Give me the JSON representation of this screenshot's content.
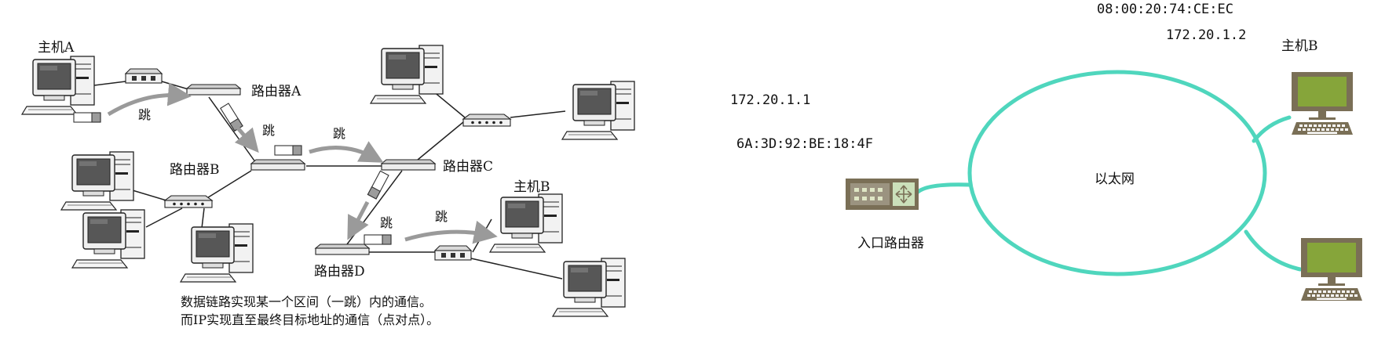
{
  "left_diagram": {
    "host_a_label": "主机A",
    "host_b_label": "主机B",
    "router_a_label": "路由器A",
    "router_b_label": "路由器B",
    "router_c_label": "路由器C",
    "router_d_label": "路由器D",
    "hop_label": "跳",
    "caption_line1": "数据链路实现某一个区间（一跳）内的通信。",
    "caption_line2": "而IP实现直至最终目标地址的通信（点对点）。"
  },
  "right_diagram": {
    "router_ip": "172.20.1.1",
    "router_mac": "6A:3D:92:BE:18:4F",
    "router_label": "入口路由器",
    "network_label": "以太网",
    "host_b_mac": "08:00:20:74:CE:EC",
    "host_b_ip": "172.20.1.2",
    "host_b_label": "主机B"
  },
  "colors": {
    "ethernet_ring": "#4fd6bd",
    "device_body": "#7a6f56",
    "screen_green": "#86a53a",
    "router_port": "#dfe6c5",
    "hop_arrow": "#9a9a9a"
  }
}
